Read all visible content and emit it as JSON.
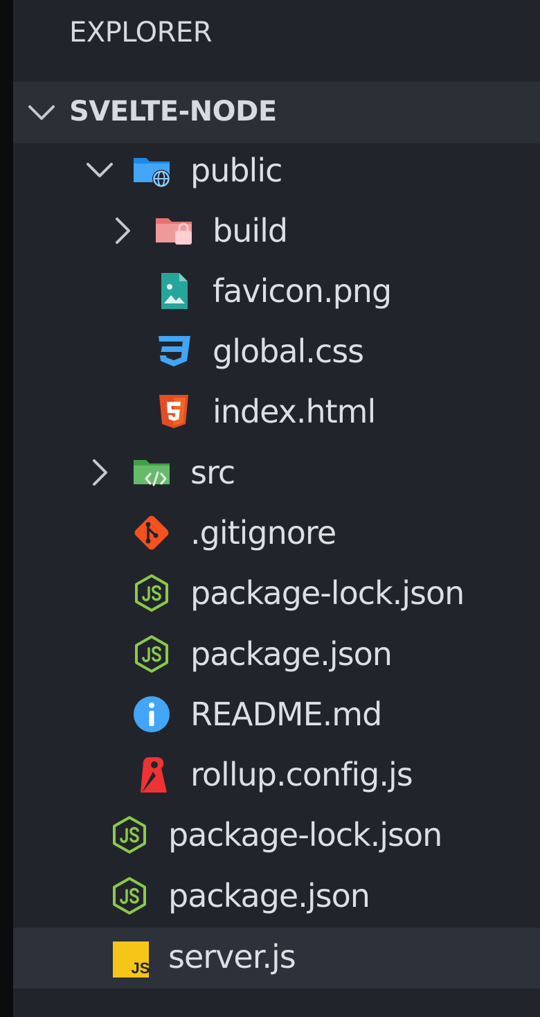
{
  "explorer": {
    "title": "EXPLORER"
  },
  "workspace": {
    "name": "SVELTE-NODE"
  },
  "tree": {
    "public": {
      "label": "public",
      "icon": "folder-public-icon"
    },
    "build": {
      "label": "build",
      "icon": "folder-build-icon"
    },
    "favicon": {
      "label": "favicon.png",
      "icon": "image-file-icon"
    },
    "global_css": {
      "label": "global.css",
      "icon": "css-file-icon"
    },
    "index_html": {
      "label": "index.html",
      "icon": "html-file-icon"
    },
    "src": {
      "label": "src",
      "icon": "folder-src-icon"
    },
    "gitignore": {
      "label": ".gitignore",
      "icon": "git-file-icon"
    },
    "package_lock_inner": {
      "label": "package-lock.json",
      "icon": "nodejs-icon"
    },
    "package_inner": {
      "label": "package.json",
      "icon": "nodejs-icon"
    },
    "readme": {
      "label": "README.md",
      "icon": "info-icon"
    },
    "rollup": {
      "label": "rollup.config.js",
      "icon": "rollup-icon"
    },
    "package_lock_root": {
      "label": "package-lock.json",
      "icon": "nodejs-icon"
    },
    "package_root": {
      "label": "package.json",
      "icon": "nodejs-icon"
    },
    "server": {
      "label": "server.js",
      "icon": "javascript-file-icon"
    }
  },
  "colors": {
    "panel_bg": "#21252b",
    "section_header_bg": "#2b2f36",
    "selected_row_bg": "#2c313a",
    "text": "#dcdfe4",
    "node_green": "#8cc84b",
    "css_blue": "#42a5f5",
    "html_orange": "#e44d26",
    "git_orange": "#f4511e",
    "info_blue": "#42a5f5",
    "rollup_red": "#ef3335",
    "js_yellow": "#f5c518"
  }
}
